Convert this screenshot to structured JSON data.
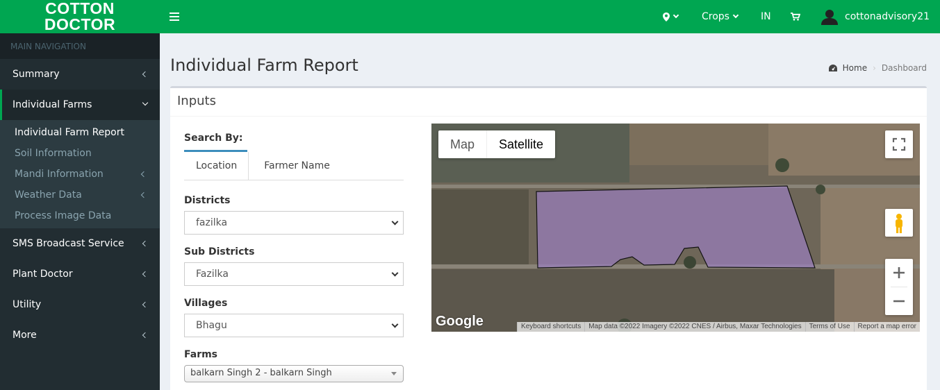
{
  "brand": {
    "line1": "COTTON",
    "line2": "DOCTOR"
  },
  "topnav": {
    "crops": "Crops",
    "lang": "IN",
    "user": "cottonadvisory21"
  },
  "sidebar": {
    "header": "MAIN NAVIGATION",
    "items": [
      {
        "label": "Summary"
      },
      {
        "label": "Individual Farms"
      },
      {
        "label": "SMS Broadcast Service"
      },
      {
        "label": "Plant Doctor"
      },
      {
        "label": "Utility"
      },
      {
        "label": "More"
      }
    ],
    "submenu": [
      {
        "label": "Individual Farm Report"
      },
      {
        "label": "Soil Information"
      },
      {
        "label": "Mandi Information"
      },
      {
        "label": "Weather Data"
      },
      {
        "label": "Process Image Data"
      }
    ]
  },
  "page": {
    "title": "Individual Farm Report"
  },
  "breadcrumb": {
    "home": "Home",
    "current": "Dashboard"
  },
  "inputs": {
    "title": "Inputs",
    "search_by": "Search By:",
    "tabs": [
      "Location",
      "Farmer Name"
    ],
    "districts": {
      "label": "Districts",
      "value": "fazilka"
    },
    "sub_districts": {
      "label": "Sub Districts",
      "value": "Fazilka"
    },
    "villages": {
      "label": "Villages",
      "value": "Bhagu"
    },
    "farms": {
      "label": "Farms",
      "value": "balkarn Singh 2 - balkarn Singh"
    }
  },
  "map": {
    "type_map": "Map",
    "type_satellite": "Satellite",
    "logo": "Google",
    "attribution": [
      "Keyboard shortcuts",
      "Map data ©2022 Imagery ©2022 CNES / Airbus, Maxar Technologies",
      "Terms of Use",
      "Report a map error"
    ]
  },
  "colors": {
    "brand_green": "#00a651",
    "sidebar_dark": "#222d32",
    "farm_overlay": "#9a7fbf"
  }
}
